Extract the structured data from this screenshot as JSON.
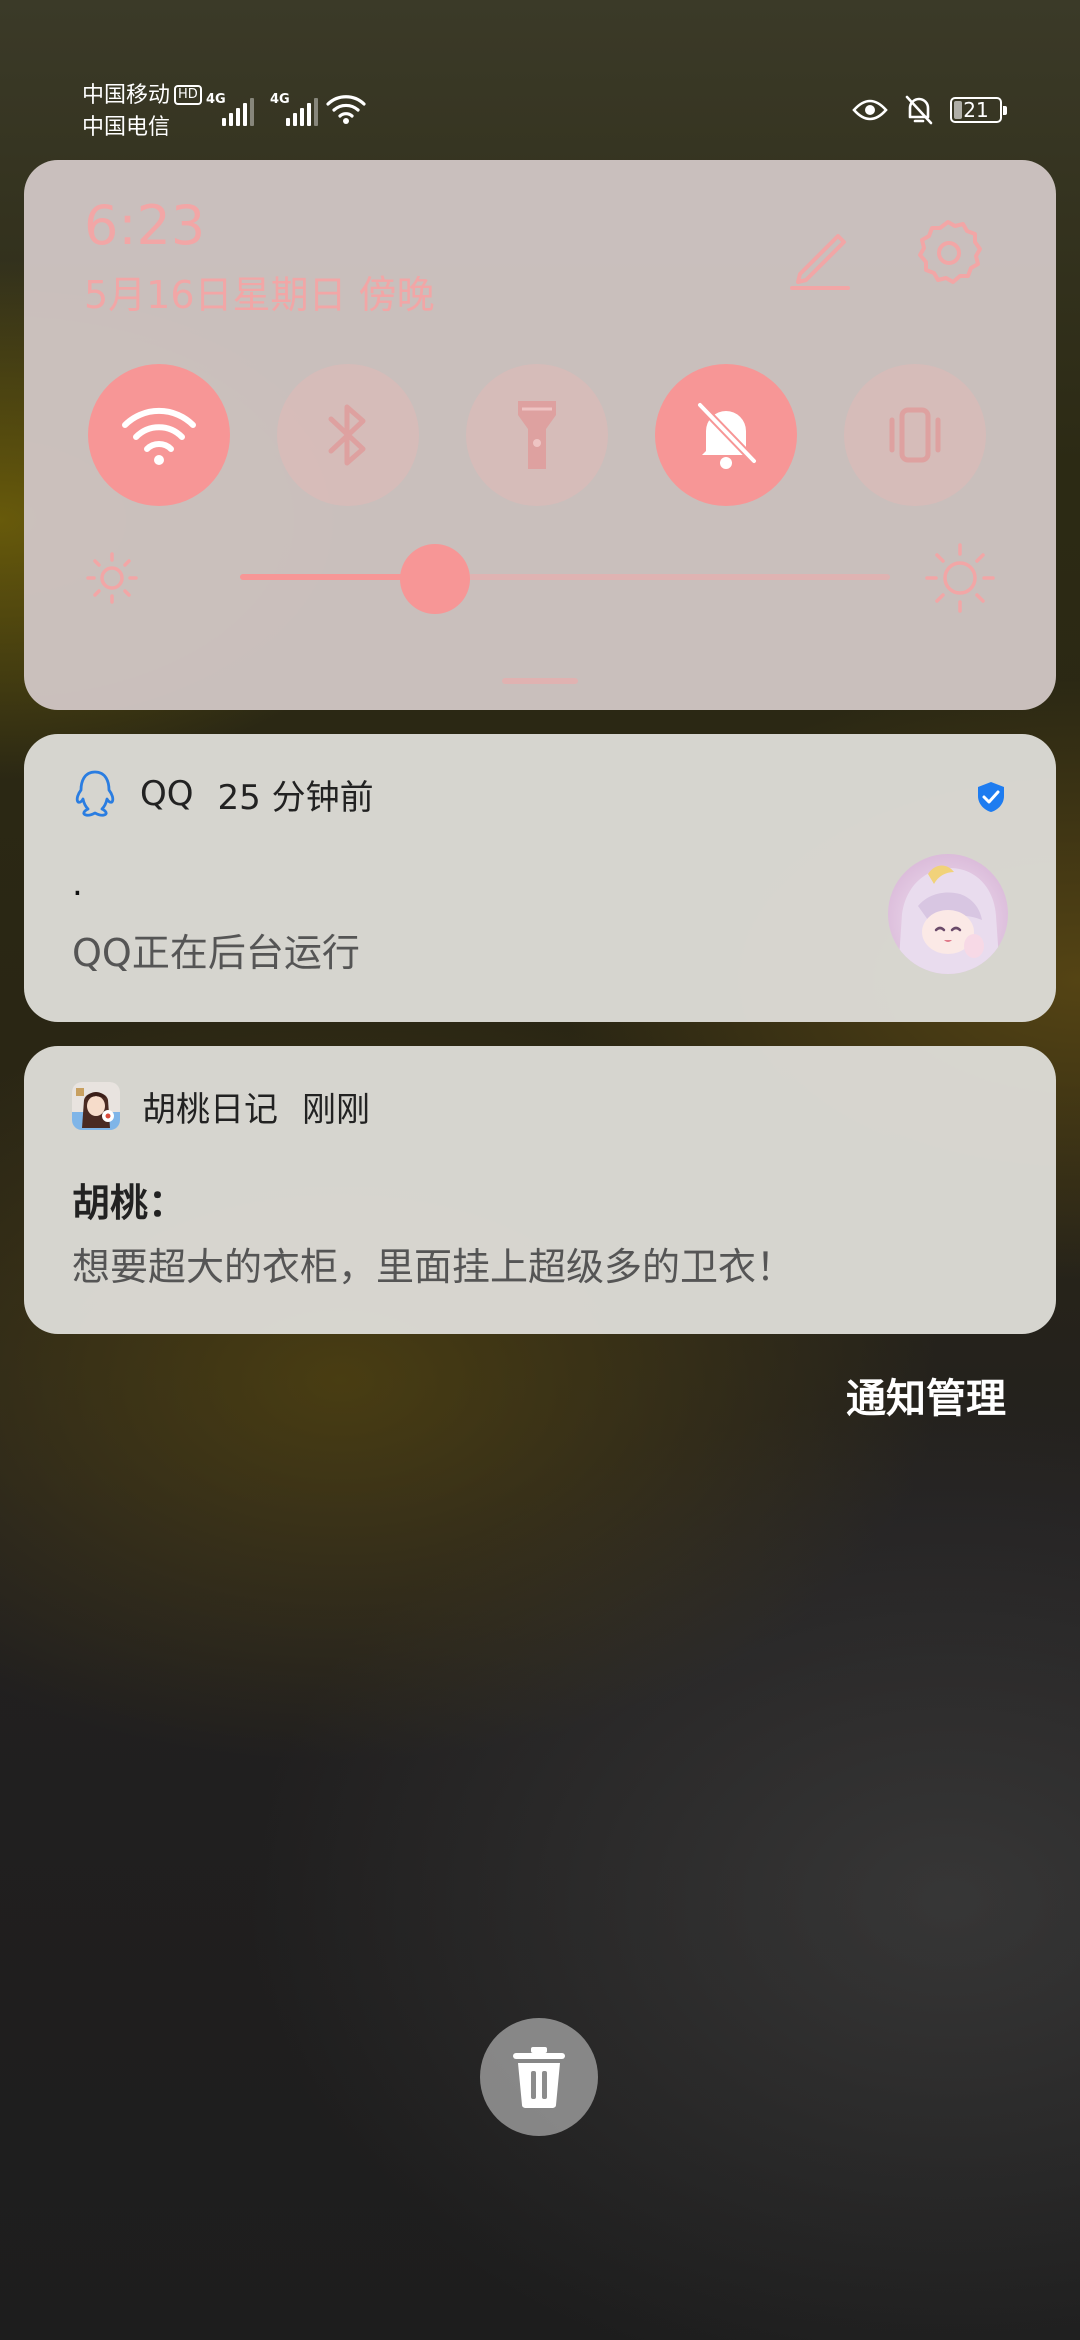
{
  "status_bar": {
    "carrier_1": "中国移动",
    "carrier_1_badge": "HD",
    "carrier_2": "中国电信",
    "sim_1_network": "4G",
    "sim_2_network": "4G",
    "battery_level": "21",
    "icons": [
      "eye-comfort-icon",
      "notifications-muted-icon",
      "wifi-icon"
    ]
  },
  "quick_settings": {
    "time": "6:23",
    "date": "5月16日星期日 傍晚",
    "tiles": [
      {
        "icon": "wifi-icon",
        "active": true
      },
      {
        "icon": "bluetooth-icon",
        "active": false
      },
      {
        "icon": "flashlight-icon",
        "active": false
      },
      {
        "icon": "bell-off-icon",
        "active": true
      },
      {
        "icon": "vibrate-icon",
        "active": false
      }
    ],
    "brightness_level": 0.3,
    "accent_color": "#f79696"
  },
  "notifications": [
    {
      "app": "QQ",
      "time": "25 分钟前",
      "title": ".",
      "body": "QQ正在后台运行",
      "badge_icon": "verified-shield-icon"
    },
    {
      "app": "胡桃日记",
      "time": "刚刚",
      "sender": "胡桃：",
      "body": "想要超大的衣柜，里面挂上超级多的卫衣！"
    }
  ],
  "actions": {
    "manage_label": "通知管理",
    "clear_icon": "trash-icon"
  }
}
